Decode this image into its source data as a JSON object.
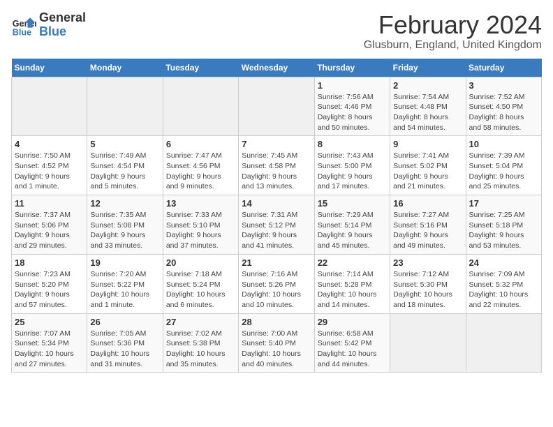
{
  "header": {
    "logo_line1": "General",
    "logo_line2": "Blue",
    "title": "February 2024",
    "subtitle": "Glusburn, England, United Kingdom"
  },
  "days_of_week": [
    "Sunday",
    "Monday",
    "Tuesday",
    "Wednesday",
    "Thursday",
    "Friday",
    "Saturday"
  ],
  "weeks": [
    [
      {
        "day": "",
        "info": ""
      },
      {
        "day": "",
        "info": ""
      },
      {
        "day": "",
        "info": ""
      },
      {
        "day": "",
        "info": ""
      },
      {
        "day": "1",
        "info": "Sunrise: 7:56 AM\nSunset: 4:46 PM\nDaylight: 8 hours\nand 50 minutes."
      },
      {
        "day": "2",
        "info": "Sunrise: 7:54 AM\nSunset: 4:48 PM\nDaylight: 8 hours\nand 54 minutes."
      },
      {
        "day": "3",
        "info": "Sunrise: 7:52 AM\nSunset: 4:50 PM\nDaylight: 8 hours\nand 58 minutes."
      }
    ],
    [
      {
        "day": "4",
        "info": "Sunrise: 7:50 AM\nSunset: 4:52 PM\nDaylight: 9 hours\nand 1 minute."
      },
      {
        "day": "5",
        "info": "Sunrise: 7:49 AM\nSunset: 4:54 PM\nDaylight: 9 hours\nand 5 minutes."
      },
      {
        "day": "6",
        "info": "Sunrise: 7:47 AM\nSunset: 4:56 PM\nDaylight: 9 hours\nand 9 minutes."
      },
      {
        "day": "7",
        "info": "Sunrise: 7:45 AM\nSunset: 4:58 PM\nDaylight: 9 hours\nand 13 minutes."
      },
      {
        "day": "8",
        "info": "Sunrise: 7:43 AM\nSunset: 5:00 PM\nDaylight: 9 hours\nand 17 minutes."
      },
      {
        "day": "9",
        "info": "Sunrise: 7:41 AM\nSunset: 5:02 PM\nDaylight: 9 hours\nand 21 minutes."
      },
      {
        "day": "10",
        "info": "Sunrise: 7:39 AM\nSunset: 5:04 PM\nDaylight: 9 hours\nand 25 minutes."
      }
    ],
    [
      {
        "day": "11",
        "info": "Sunrise: 7:37 AM\nSunset: 5:06 PM\nDaylight: 9 hours\nand 29 minutes."
      },
      {
        "day": "12",
        "info": "Sunrise: 7:35 AM\nSunset: 5:08 PM\nDaylight: 9 hours\nand 33 minutes."
      },
      {
        "day": "13",
        "info": "Sunrise: 7:33 AM\nSunset: 5:10 PM\nDaylight: 9 hours\nand 37 minutes."
      },
      {
        "day": "14",
        "info": "Sunrise: 7:31 AM\nSunset: 5:12 PM\nDaylight: 9 hours\nand 41 minutes."
      },
      {
        "day": "15",
        "info": "Sunrise: 7:29 AM\nSunset: 5:14 PM\nDaylight: 9 hours\nand 45 minutes."
      },
      {
        "day": "16",
        "info": "Sunrise: 7:27 AM\nSunset: 5:16 PM\nDaylight: 9 hours\nand 49 minutes."
      },
      {
        "day": "17",
        "info": "Sunrise: 7:25 AM\nSunset: 5:18 PM\nDaylight: 9 hours\nand 53 minutes."
      }
    ],
    [
      {
        "day": "18",
        "info": "Sunrise: 7:23 AM\nSunset: 5:20 PM\nDaylight: 9 hours\nand 57 minutes."
      },
      {
        "day": "19",
        "info": "Sunrise: 7:20 AM\nSunset: 5:22 PM\nDaylight: 10 hours\nand 1 minute."
      },
      {
        "day": "20",
        "info": "Sunrise: 7:18 AM\nSunset: 5:24 PM\nDaylight: 10 hours\nand 6 minutes."
      },
      {
        "day": "21",
        "info": "Sunrise: 7:16 AM\nSunset: 5:26 PM\nDaylight: 10 hours\nand 10 minutes."
      },
      {
        "day": "22",
        "info": "Sunrise: 7:14 AM\nSunset: 5:28 PM\nDaylight: 10 hours\nand 14 minutes."
      },
      {
        "day": "23",
        "info": "Sunrise: 7:12 AM\nSunset: 5:30 PM\nDaylight: 10 hours\nand 18 minutes."
      },
      {
        "day": "24",
        "info": "Sunrise: 7:09 AM\nSunset: 5:32 PM\nDaylight: 10 hours\nand 22 minutes."
      }
    ],
    [
      {
        "day": "25",
        "info": "Sunrise: 7:07 AM\nSunset: 5:34 PM\nDaylight: 10 hours\nand 27 minutes."
      },
      {
        "day": "26",
        "info": "Sunrise: 7:05 AM\nSunset: 5:36 PM\nDaylight: 10 hours\nand 31 minutes."
      },
      {
        "day": "27",
        "info": "Sunrise: 7:02 AM\nSunset: 5:38 PM\nDaylight: 10 hours\nand 35 minutes."
      },
      {
        "day": "28",
        "info": "Sunrise: 7:00 AM\nSunset: 5:40 PM\nDaylight: 10 hours\nand 40 minutes."
      },
      {
        "day": "29",
        "info": "Sunrise: 6:58 AM\nSunset: 5:42 PM\nDaylight: 10 hours\nand 44 minutes."
      },
      {
        "day": "",
        "info": ""
      },
      {
        "day": "",
        "info": ""
      }
    ]
  ]
}
